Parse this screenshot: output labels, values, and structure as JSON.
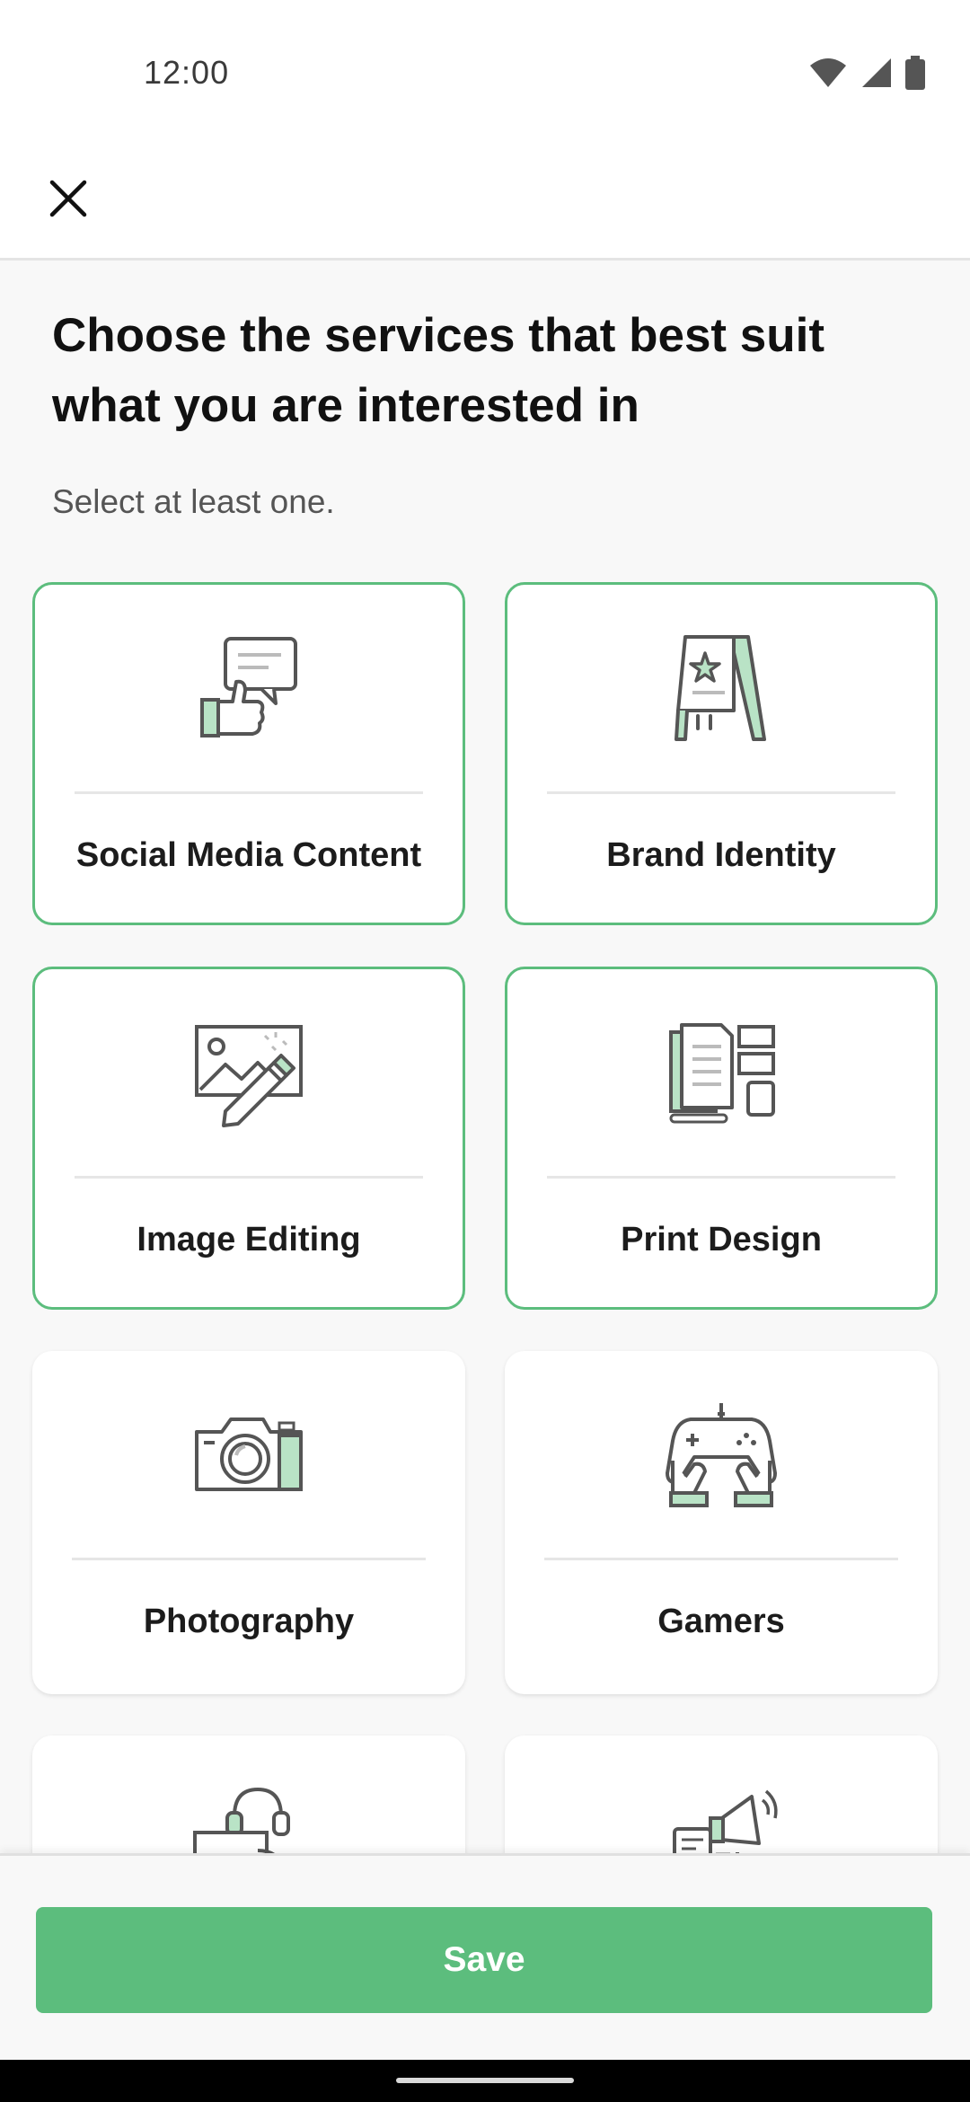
{
  "status": {
    "time": "12:00",
    "icons": [
      "wifi-icon",
      "cellular-signal-icon",
      "battery-icon"
    ]
  },
  "toolbar": {
    "close_icon": "close-icon"
  },
  "header": {
    "title": "Choose the services that best suit what you are interested in",
    "subtitle": "Select at least one."
  },
  "colors": {
    "accent": "#5cbd7d",
    "accent_light": "#b9e3c6",
    "icon_stroke": "#555555"
  },
  "services": [
    {
      "label": "Social Media Content",
      "icon": "social-media-thumbs-up-icon",
      "selected": true
    },
    {
      "label": "Brand Identity",
      "icon": "signboard-star-icon",
      "selected": true
    },
    {
      "label": "Image Editing",
      "icon": "image-edit-pen-icon",
      "selected": true
    },
    {
      "label": "Print Design",
      "icon": "print-documents-icon",
      "selected": true
    },
    {
      "label": "Photography",
      "icon": "camera-icon",
      "selected": false
    },
    {
      "label": "Gamers",
      "icon": "gamepad-hands-icon",
      "selected": false
    },
    {
      "label": "",
      "icon": "headset-support-icon",
      "selected": false
    },
    {
      "label": "",
      "icon": "megaphone-marketing-icon",
      "selected": false
    }
  ],
  "footer": {
    "save_label": "Save"
  }
}
